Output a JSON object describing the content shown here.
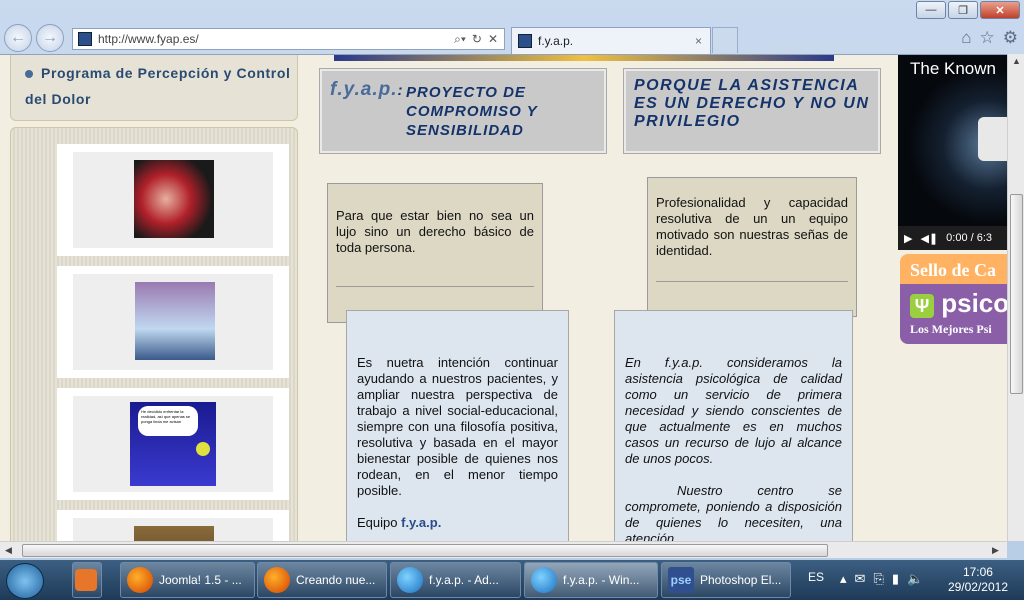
{
  "browser": {
    "url": "http://www.fyap.es/",
    "tab_title": "f.y.a.p.",
    "tab_close": "×"
  },
  "sidebar": {
    "menu_item": "Programa de Percepción y Control del Dolor",
    "cartoon_bubble": "He decidido enfrentar la realidad, así que apenas se ponga linda me avisan"
  },
  "header_left": {
    "brand": "f.y.a.p.",
    "sep": ":",
    "title": "PROYECTO DE COMPROMISO Y SENSIBILIDAD"
  },
  "header_right": {
    "title": "PORQUE LA ASISTENCIA ES UN DERECHO Y NO UN PRIVILEGIO"
  },
  "cards": {
    "c1": "Para que estar bien no sea un lujo sino un derecho básico de toda persona.",
    "c2": "Profesionalidad y capacidad resolutiva de un un equipo motivado son nuestras señas de identidad.",
    "b1": "Es nuetra intención continuar ayudando a nuestros pacientes, y ampliar nuestra perspectiva de trabajo a nivel social-educacional, siempre con una filosofía positiva, resolutiva y basada en el mayor bienestar posible de quienes nos rodean, en el menor tiempo posible.",
    "b1_sig_prefix": "Equipo",
    "b1_sig_brand": "f.y.a.p.",
    "b2a": "En f.y.a.p. consideramos la asistencia psicológica de calidad como un servicio de primera necesidad y siendo conscientes de que actualmente es en muchos casos un recurso de lujo al alcance de unos pocos.",
    "b2b": "Nuestro centro se compromete, poniendo a disposición de quienes lo necesiten, una atención"
  },
  "right": {
    "video_title": "The Known",
    "video_time": "0:00 / 6:3",
    "ad_line1": "Sello de Ca",
    "ad_line2": "psico",
    "ad_line3": "Los Mejores Psi"
  },
  "taskbar": {
    "items": [
      "Joomla! 1.5 - ...",
      "Creando nue...",
      "f.y.a.p. - Ad...",
      "f.y.a.p. - Win...",
      "Photoshop El..."
    ],
    "ps_label": "pse",
    "lang": "ES",
    "time": "17:06",
    "date": "29/02/2012"
  }
}
